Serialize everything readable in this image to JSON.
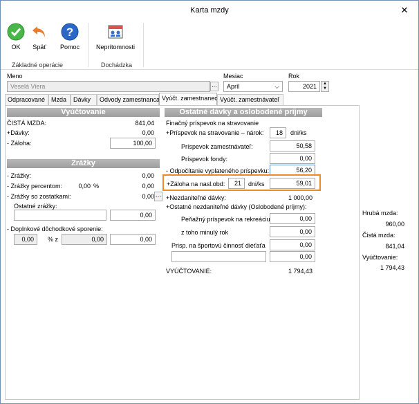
{
  "window": {
    "title": "Karta mzdy",
    "close_glyph": "✕"
  },
  "ribbon": {
    "ok_label": "OK",
    "back_label": "Späť",
    "help_label": "Pomoc",
    "absence_label": "Neprítomnosti",
    "group_basic": "Základné operácie",
    "group_attendance": "Dochádzka",
    "icons": {
      "ok": "check-circle-icon",
      "back": "undo-arrow-icon",
      "help": "question-icon",
      "absence": "calendar-people-icon"
    }
  },
  "header": {
    "name_label": "Meno",
    "name_value": "Veselá Viera",
    "name_button": "...",
    "month_label": "Mesiac",
    "month_value": "Apríl",
    "year_label": "Rok",
    "year_value": "2021"
  },
  "tabs": [
    {
      "label": "Odpracované"
    },
    {
      "label": "Mzda"
    },
    {
      "label": "Dávky"
    },
    {
      "label": "Odvody zamestnanca"
    },
    {
      "label": "Vyúčt. zamestnanec"
    },
    {
      "label": "Vyúčt. zamestnávateľ"
    }
  ],
  "left": {
    "vyuctovanie_title": "Vyúčtovanie",
    "cista_mzda_label": "ČISTÁ MZDA:",
    "cista_mzda_value": "841,04",
    "davky_label": "+Dávky:",
    "davky_value": "0,00",
    "zaloha_label": "- Záloha:",
    "zaloha_value": "100,00",
    "zrazky_title": "Zrážky",
    "zrazky_label": "- Zrážky:",
    "zrazky_value": "0,00",
    "zrazky_percent_label": "- Zrážky percentom:",
    "zrazky_percent_pct": "0,00",
    "zrazky_percent_sign": "%",
    "zrazky_percent_value": "0,00",
    "zrazky_zost_label": "- Zrážky so zostatkami:",
    "zrazky_zost_value": "0,00",
    "ostatne_label": "Ostatné zrážky:",
    "ostatne_value": "0,00",
    "ddp_label": "- Doplnkové dôchodkové sporenie:",
    "ddp_value1": "0,00",
    "ddp_mid_label": "% z",
    "ddp_value2": "0,00",
    "ddp_value3": "0,00"
  },
  "right": {
    "title": "Ostatné dávky a oslobodené príjmy",
    "financny_label": "Finačný príspevok na stravovanie",
    "narok_label": "+Príspevok na stravovanie – nárok:",
    "narok_count": "18",
    "narok_unit": "dni/ks",
    "zamestnavatel_label": "Príspevok zamestnávateľ:",
    "zamestnavatel_value": "50,58",
    "fondy_label": "Príspevok fondy:",
    "fondy_value": "0,00",
    "odpocet_label": "- Odpočítanie vyplateného príspevku:",
    "odpocet_value": "56,20",
    "zaloha_label": "+Záloha na nasl.obd:",
    "zaloha_count": "21",
    "zaloha_unit": "dni/ks",
    "zaloha_value": "59,01",
    "nezdanitelne_label": "+Nezdaniteľné dávky:",
    "nezdanitelne_value": "1 000,00",
    "ostatne_label": "+Ostatné nezdaniteľné dávky (Oslobodené príjmy):",
    "rekreacia_label": "Peňažný príspevok na rekreáciu",
    "rekreacia_value": "0,00",
    "minuly_label": "z toho minulý rok",
    "minuly_value": "0,00",
    "sport_label": "Prisp. na športovú činnosť dieťaťa",
    "sport_value": "0,00",
    "extra_text": "",
    "extra_value": "0,00",
    "vyuctovanie_label": "VYÚČTOVANIE:",
    "vyuctovanie_value": "1 794,43"
  },
  "summary": {
    "hruba_label": "Hrubá mzda:",
    "hruba_value": "960,00",
    "cista_label": "Čistá mzda:",
    "cista_value": "841,04",
    "vyuct_label": "Vyúčtovanie:",
    "vyuct_value": "1 794,43"
  }
}
